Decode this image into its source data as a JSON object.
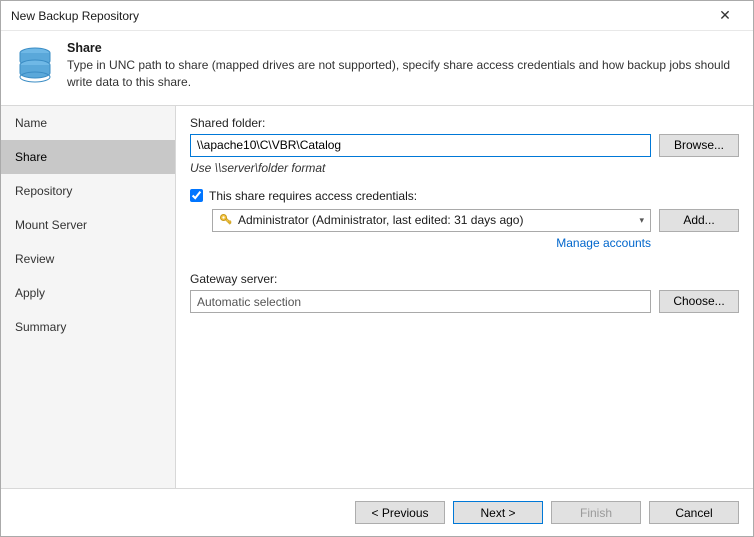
{
  "window": {
    "title": "New Backup Repository",
    "close_glyph": "✕"
  },
  "header": {
    "title": "Share",
    "subtitle": "Type in UNC path to share (mapped drives are not supported), specify share access credentials and how backup jobs should write data to this share."
  },
  "sidebar": {
    "items": [
      {
        "label": "Name"
      },
      {
        "label": "Share"
      },
      {
        "label": "Repository"
      },
      {
        "label": "Mount Server"
      },
      {
        "label": "Review"
      },
      {
        "label": "Apply"
      },
      {
        "label": "Summary"
      }
    ],
    "active_index": 1
  },
  "content": {
    "shared_folder_label": "Shared folder:",
    "shared_folder_value": "\\\\apache10\\C\\VBR\\Catalog",
    "shared_folder_hint": "Use \\\\server\\folder format",
    "browse_button": "Browse...",
    "credentials_checkbox_label": "This share requires access credentials:",
    "credentials_checked": true,
    "credentials_dropdown_text": "Administrator (Administrator, last edited: 31 days ago)",
    "add_button": "Add...",
    "manage_accounts_link": "Manage accounts",
    "gateway_label": "Gateway server:",
    "gateway_value": "Automatic selection",
    "choose_button": "Choose..."
  },
  "footer": {
    "previous": "< Previous",
    "next": "Next >",
    "finish": "Finish",
    "cancel": "Cancel"
  }
}
